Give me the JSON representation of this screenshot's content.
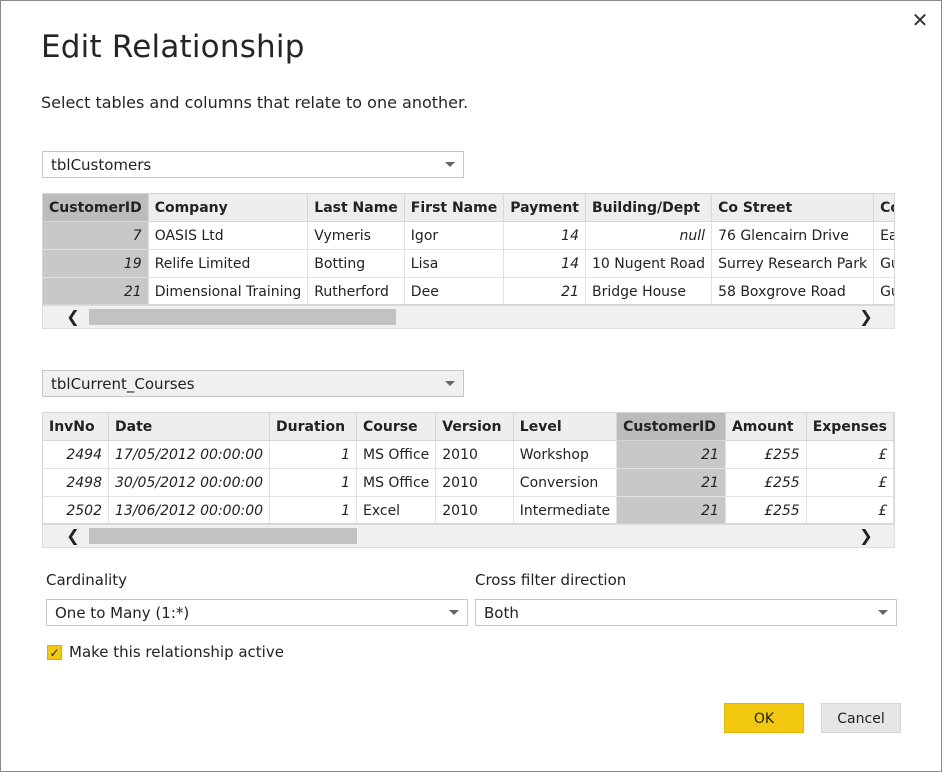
{
  "dialog": {
    "title": "Edit Relationship",
    "subtitle": "Select tables and columns that relate to one another.",
    "close_icon": "✕"
  },
  "table1": {
    "selected": "tblCustomers",
    "columns": [
      "CustomerID",
      "Company",
      "Last Name",
      "First Name",
      "Payment",
      "Building/Dept",
      "Co Street",
      "Co"
    ],
    "rows": [
      [
        "7",
        "OASIS Ltd",
        "Vymeris",
        "Igor",
        "14",
        "null",
        "76 Glencairn Drive",
        "Ea"
      ],
      [
        "19",
        "Relife Limited",
        "Botting",
        "Lisa",
        "14",
        "10 Nugent Road",
        "Surrey Research Park",
        "Gu"
      ],
      [
        "21",
        "Dimensional Training",
        "Rutherford",
        "Dee",
        "21",
        "Bridge House",
        "58 Boxgrove Road",
        "Gu"
      ]
    ],
    "selected_column": 0
  },
  "table2": {
    "selected": "tblCurrent_Courses",
    "columns": [
      "InvNo",
      "Date",
      "Duration",
      "Course",
      "Version",
      "Level",
      "CustomerID",
      "Amount",
      "Expenses"
    ],
    "rows": [
      [
        "2494",
        "17/05/2012 00:00:00",
        "1",
        "MS Office",
        "2010",
        "Workshop",
        "21",
        "£255",
        "£"
      ],
      [
        "2498",
        "30/05/2012 00:00:00",
        "1",
        "MS Office",
        "2010",
        "Conversion",
        "21",
        "£255",
        "£"
      ],
      [
        "2502",
        "13/06/2012 00:00:00",
        "1",
        "Excel",
        "2010",
        "Intermediate",
        "21",
        "£255",
        "£"
      ]
    ],
    "selected_column": 6
  },
  "cardinality": {
    "label": "Cardinality",
    "value": "One to Many (1:*)"
  },
  "cross_filter": {
    "label": "Cross filter direction",
    "value": "Both"
  },
  "active_checkbox": {
    "label": "Make this relationship active",
    "checked": true,
    "mark": "✓"
  },
  "buttons": {
    "ok": "OK",
    "cancel": "Cancel"
  },
  "scroll": {
    "left_arrow": "❮",
    "right_arrow": "❯"
  },
  "colors": {
    "accent": "#f2c811",
    "selected_column": "#c8c8c8"
  }
}
